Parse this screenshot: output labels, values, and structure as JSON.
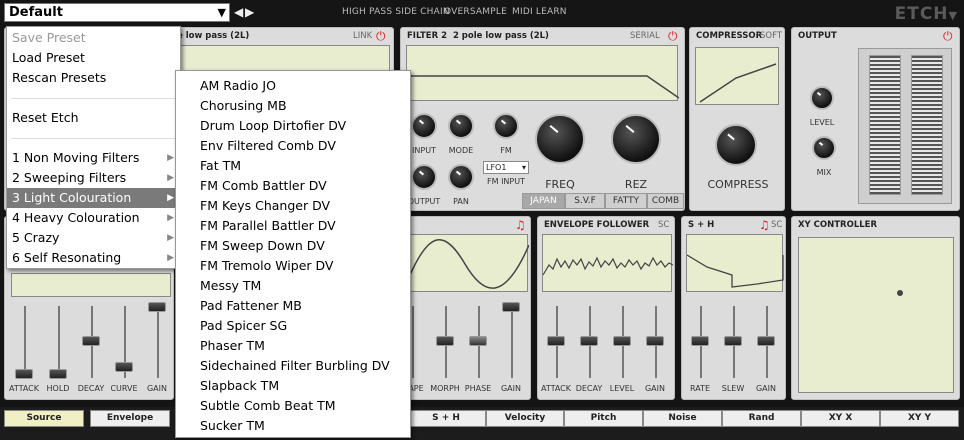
{
  "topbar": {
    "preset_value": "Default",
    "links": [
      "HIGH PASS SIDE CHAIN",
      "OVERSAMPLE",
      "MIDI LEARN"
    ],
    "logo": "ETCH"
  },
  "filter1": {
    "title": "e low pass (2L)",
    "tag": "LINK"
  },
  "filter2": {
    "title": "FILTER 2",
    "subtitle": "2 pole low pass (2L)",
    "tag": "SERIAL",
    "knobs": [
      "INPUT",
      "MODE",
      "FM",
      "OUTPUT",
      "PAN"
    ],
    "fm_select": "LFO1",
    "fm_input_label": "FM INPUT",
    "big_knobs": [
      "FREQ",
      "REZ"
    ],
    "modes": [
      "JAPAN",
      "S.V.F",
      "FATTY",
      "COMB"
    ],
    "selected_mode": "JAPAN"
  },
  "compressor": {
    "title": "COMPRESSOR",
    "tag": "SOFT",
    "knob": "COMPRESS"
  },
  "output": {
    "title": "OUTPUT",
    "knobs": [
      "LEVEL",
      "MIX"
    ]
  },
  "lfo": {
    "sliders": [
      "APE",
      "MORPH",
      "PHASE",
      "GAIN"
    ]
  },
  "envfollow": {
    "title": "ENVELOPE FOLLOWER",
    "tag": "SC",
    "sliders": [
      "ATTACK",
      "DECAY",
      "LEVEL",
      "GAIN"
    ]
  },
  "sh": {
    "title": "S + H",
    "tag": "SC",
    "sliders": [
      "RATE",
      "SLEW",
      "GAIN"
    ]
  },
  "xy": {
    "title": "XY CONTROLLER"
  },
  "envelope": {
    "sliders": [
      "ATTACK",
      "HOLD",
      "DECAY",
      "CURVE",
      "GAIN"
    ]
  },
  "bottom_tabs": [
    "Source",
    "Envelope",
    "S + H",
    "Velocity",
    "Pitch",
    "Noise",
    "Rand",
    "XY X",
    "XY Y"
  ],
  "menu": {
    "items": [
      "Save Preset",
      "Load Preset",
      "Rescan Presets",
      "Reset Etch",
      "1 Non Moving Filters",
      "2 Sweeping Filters",
      "3 Light Colouration",
      "4 Heavy Colouration",
      "5 Crazy",
      "6 Self Resonating"
    ],
    "selected": "3 Light Colouration",
    "submenu_arrow": "▶"
  },
  "submenu": {
    "items": [
      "AM Radio JO",
      "Chorusing MB",
      "Drum Loop Dirtofier DV",
      "Env Filtered Comb DV",
      "Fat TM",
      "FM Comb Battler DV",
      "FM Keys Changer DV",
      "FM Parallel Battler DV",
      "FM Sweep Down DV",
      "FM Tremolo Wiper DV",
      "Messy TM",
      "Pad Fattener MB",
      "Pad Spicer SG",
      "Phaser TM",
      "Sidechained Filter Burbling DV",
      "Slapback TM",
      "Subtle Comb Beat TM",
      "Sucker TM"
    ]
  },
  "colors": {
    "lcd": "#e9edd0",
    "panel": "#dcdcdc",
    "selected": "#7a7a7a",
    "power": "#dd2222",
    "active_tab": "#f1f0c4"
  }
}
